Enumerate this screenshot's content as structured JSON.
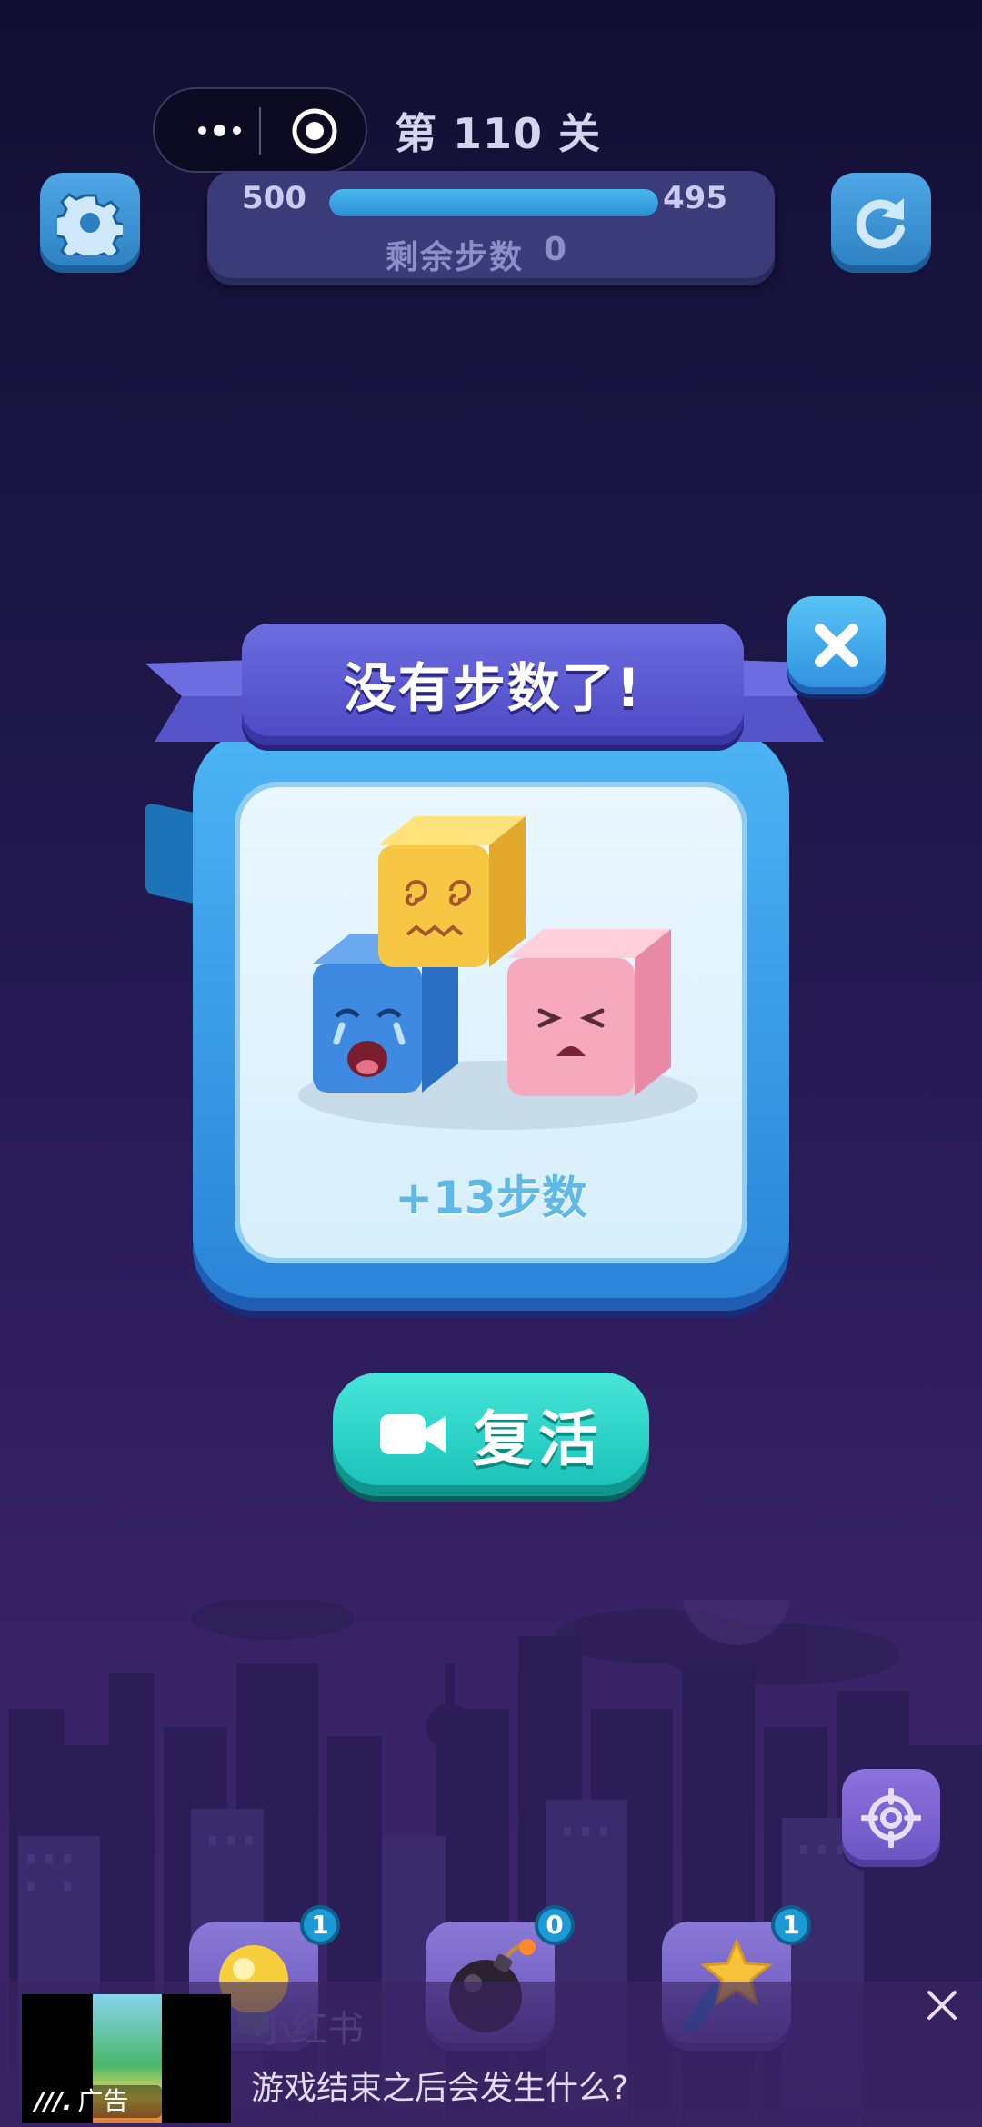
{
  "top_bar": {
    "level_title": "第 110 关",
    "score_left": "500",
    "score_right": "495",
    "steps_label": "剩余步数",
    "steps_value": "0",
    "progress_fraction": 1.0
  },
  "popup": {
    "title": "没有步数了!",
    "bonus_text": "+13步数",
    "revive_label": "复活"
  },
  "boosters": [
    {
      "icon": "lightbulb-icon",
      "count": "1"
    },
    {
      "icon": "bomb-icon",
      "count": "0"
    },
    {
      "icon": "magic-wand-icon",
      "count": "1"
    }
  ],
  "ad": {
    "tag": "广告",
    "brand": "小红书",
    "text": "游戏结束之后会发生什么?"
  },
  "colors": {
    "panel": "#3a3b78",
    "accent_blue": "#2c7fc2",
    "revive": "#18c0b6",
    "ribbon": "#4c48c4"
  }
}
